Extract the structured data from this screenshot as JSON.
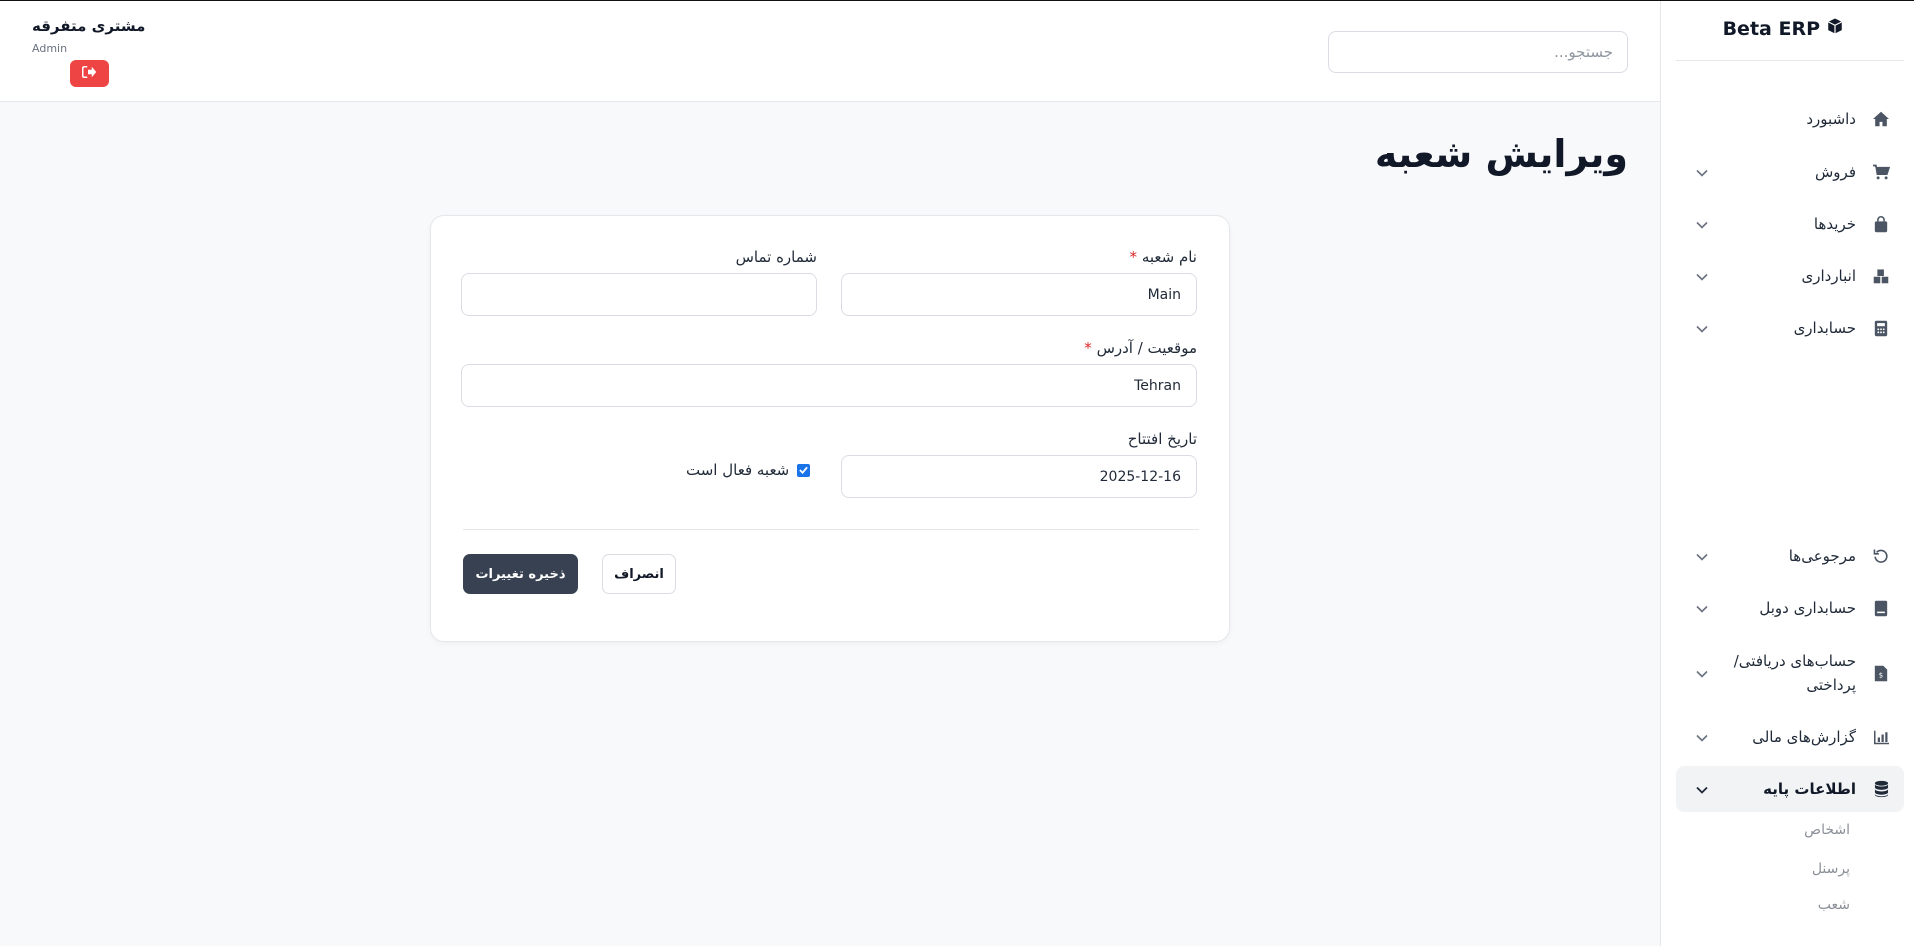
{
  "app": {
    "brand": "Beta ERP"
  },
  "header": {
    "search_placeholder": "جستجو...",
    "user_name": "مشتری متفرقه",
    "user_role": "Admin"
  },
  "sidebar": {
    "items": [
      {
        "label": "داشبورد",
        "icon": "home-icon",
        "has_chevron": false
      },
      {
        "label": "فروش",
        "icon": "cart-icon",
        "has_chevron": true
      },
      {
        "label": "خریدها",
        "icon": "bag-icon",
        "has_chevron": true
      },
      {
        "label": "انبارداری",
        "icon": "warehouse-icon",
        "has_chevron": true
      },
      {
        "label": "حسابداری",
        "icon": "calculator-icon",
        "has_chevron": true
      },
      {
        "label": "مرجوعی‌ها",
        "icon": "undo-icon",
        "has_chevron": true
      },
      {
        "label": "حسابداری دوبل",
        "icon": "book-icon",
        "has_chevron": true
      },
      {
        "label": "حساب‌های دریافتی/ پرداختی",
        "icon": "invoice-icon",
        "has_chevron": true
      },
      {
        "label": "گزارش‌های مالی",
        "icon": "chart-icon",
        "has_chevron": true
      },
      {
        "label": "اطلاعات پایه",
        "icon": "database-icon",
        "has_chevron": true,
        "active": true
      }
    ],
    "subitems": [
      "اشخاص",
      "پرسنل",
      "شعب"
    ]
  },
  "page": {
    "title": "ویرایش شعبه"
  },
  "form": {
    "branch_name_label": "نام شعبه",
    "branch_name_value": "Main",
    "phone_label": "شماره تماس",
    "phone_value": "",
    "address_label": "موقعیت / آدرس",
    "address_value": "Tehran",
    "opening_date_label": "تاریخ افتتاح",
    "opening_date_value": "2025-12-16",
    "active_label": "شعبه فعال است",
    "active_checked": true,
    "required_mark": "*",
    "save_label": "ذخیره تغییرات",
    "cancel_label": "انصراف"
  },
  "colors": {
    "primary_button": "#374151",
    "logout_button": "#ef4444",
    "required": "#dc2626",
    "checkbox": "#1a73e8"
  }
}
